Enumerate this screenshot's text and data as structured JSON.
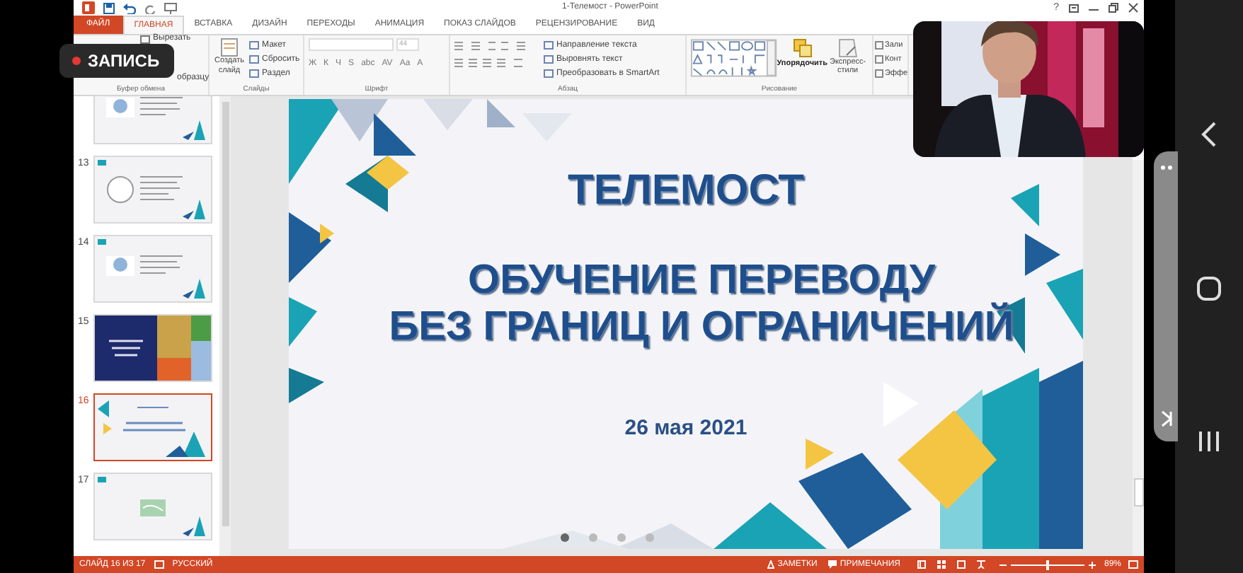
{
  "record_badge": {
    "label": "ЗАПИСЬ"
  },
  "window": {
    "title": "1-Телемост - PowerPoint",
    "help": "?"
  },
  "tabs": [
    {
      "label": "ФАЙЛ",
      "kind": "file",
      "selected": false
    },
    {
      "label": "ГЛАВНАЯ",
      "kind": "tab",
      "selected": true
    },
    {
      "label": "ВСТАВКА",
      "kind": "tab",
      "selected": false
    },
    {
      "label": "ДИЗАЙН",
      "kind": "tab",
      "selected": false
    },
    {
      "label": "ПЕРЕХОДЫ",
      "kind": "tab",
      "selected": false
    },
    {
      "label": "АНИМАЦИЯ",
      "kind": "tab",
      "selected": false
    },
    {
      "label": "ПОКАЗ СЛАЙДОВ",
      "kind": "tab",
      "selected": false
    },
    {
      "label": "РЕЦЕНЗИРОВАНИЕ",
      "kind": "tab",
      "selected": false
    },
    {
      "label": "ВИД",
      "kind": "tab",
      "selected": false
    }
  ],
  "ribbon": {
    "groups": [
      {
        "kind": "clipboard",
        "label": "Буфер обмена",
        "items": [
          "Вырезать",
          "образцу"
        ]
      },
      {
        "kind": "slides",
        "label": "Слайды",
        "big": "Создать слайд",
        "items": [
          "Макет",
          "Сбросить",
          "Раздел"
        ]
      },
      {
        "kind": "font",
        "label": "Шрифт",
        "size": "44",
        "items": [
          "Ж",
          "К",
          "Ч",
          "S",
          "abc",
          "AV",
          "Aa",
          "A"
        ]
      },
      {
        "kind": "paragraph",
        "label": "Абзац",
        "items": [
          "Направление текста",
          "Выровнять текст",
          "Преобразовать в SmartArt"
        ]
      },
      {
        "kind": "drawing",
        "label": "Рисование",
        "items": [
          "Упорядочить",
          "Экспресс-стили"
        ]
      },
      {
        "kind": "editing",
        "items": [
          "Зали",
          "Конт",
          "Эффе"
        ]
      }
    ]
  },
  "thumbnails": [
    {
      "kind": "logo",
      "selected": false
    },
    {
      "number": "13",
      "kind": "seal",
      "selected": false
    },
    {
      "number": "14",
      "kind": "logo",
      "selected": false
    },
    {
      "number": "15",
      "kind": "poster",
      "selected": false
    },
    {
      "number": "16",
      "kind": "title",
      "selected": true
    },
    {
      "number": "17",
      "kind": "map",
      "selected": false
    }
  ],
  "slide": {
    "title": "ТЕЛЕМОСТ",
    "heading": [
      "ОБУЧЕНИЕ ПЕРЕВОДУ",
      "БЕЗ ГРАНИЦ И ОГРАНИЧЕНИЙ"
    ],
    "date": "26 мая 2021"
  },
  "pager": [
    {
      "selected": true
    },
    {
      "selected": false
    },
    {
      "selected": false
    },
    {
      "selected": false
    }
  ],
  "status_bar": {
    "slide_info": "СЛАЙД 16 ИЗ 17",
    "language": "РУССКИЙ",
    "notes": "ЗАМЕТКИ",
    "comments": "ПРИМЕЧАНИЯ",
    "zoom": {
      "level": 0.5,
      "value": "89%"
    }
  }
}
